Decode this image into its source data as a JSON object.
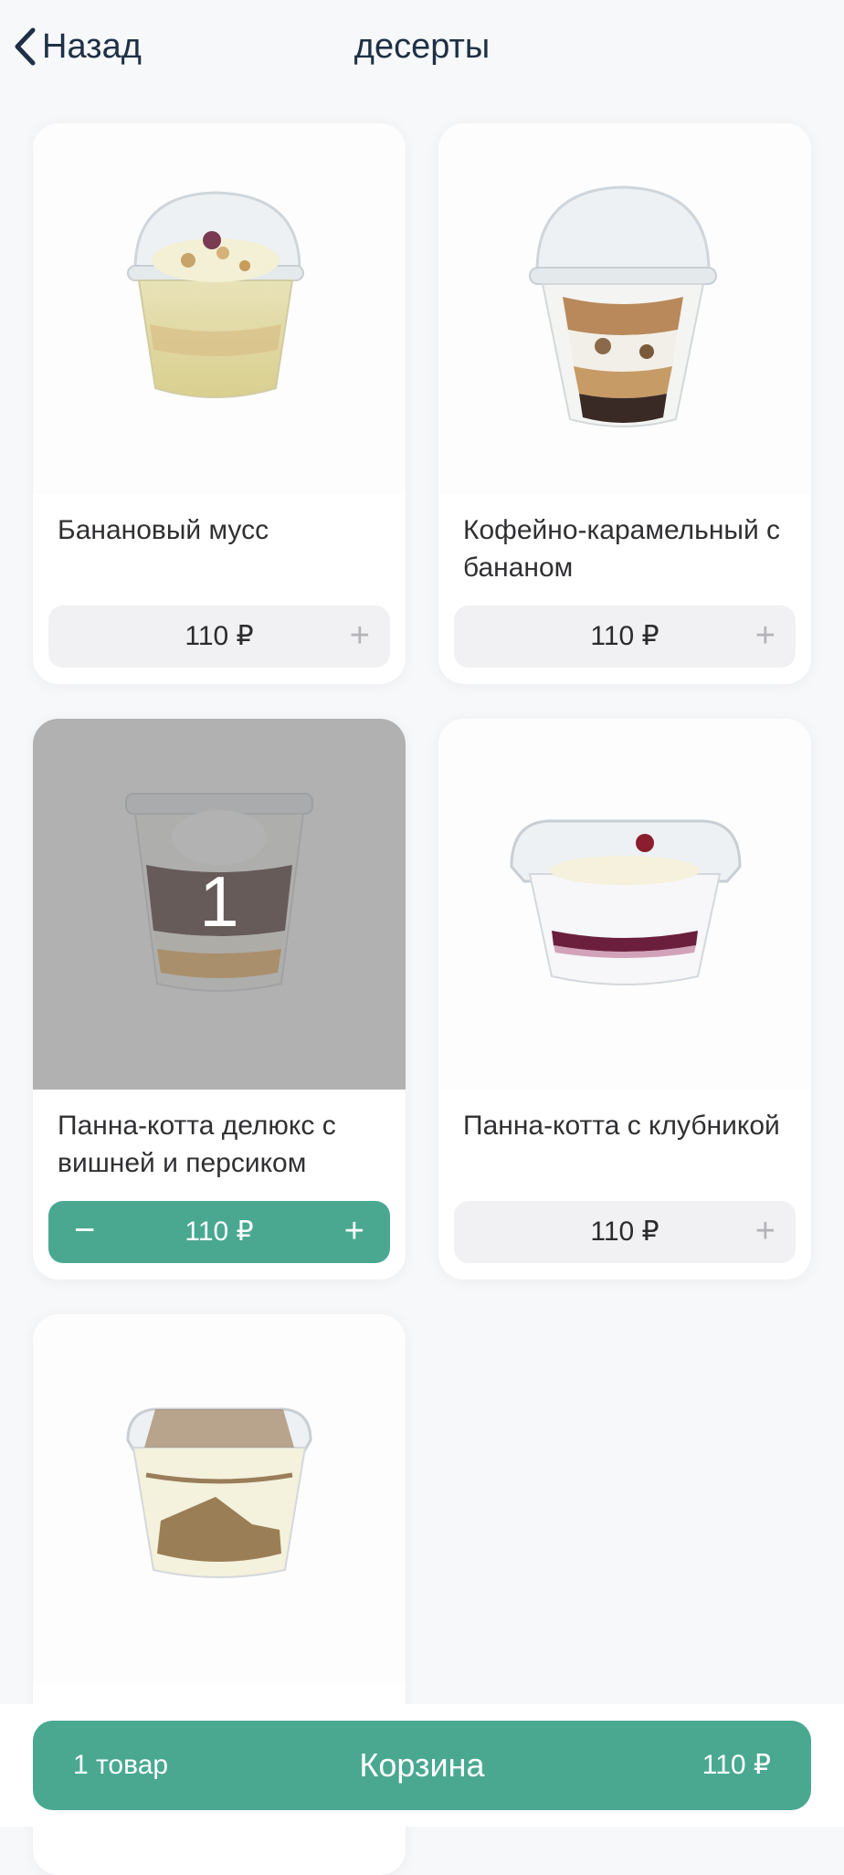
{
  "header": {
    "back_label": "Назад",
    "title": "десерты"
  },
  "products": [
    {
      "name": "Банановый мусс",
      "price": "110 ₽",
      "plus": "+",
      "image": "banana-mousse-cup-image"
    },
    {
      "name": "Кофейно-карамельный с бананом",
      "price": "110 ₽",
      "plus": "+",
      "image": "coffee-caramel-banana-cup-image"
    },
    {
      "name": "Панна-котта делюкс с вишней и персиком",
      "price": "110 ₽",
      "plus": "+",
      "minus": "−",
      "quantity": "1",
      "in_cart": true,
      "image": "panna-cotta-deluxe-cup-image"
    },
    {
      "name": "Панна-котта с клубникой",
      "price": "110 ₽",
      "plus": "+",
      "image": "panna-cotta-strawberry-cup-image"
    },
    {
      "name": "",
      "image": "tiramisu-box-image"
    }
  ],
  "cart": {
    "count": "1 товар",
    "label": "Корзина",
    "total": "110 ₽"
  },
  "colors": {
    "accent": "#4aa891",
    "header_text": "#1f3045",
    "page_background": "#f7f8fa",
    "price_button_background": "#f1f1f3"
  }
}
